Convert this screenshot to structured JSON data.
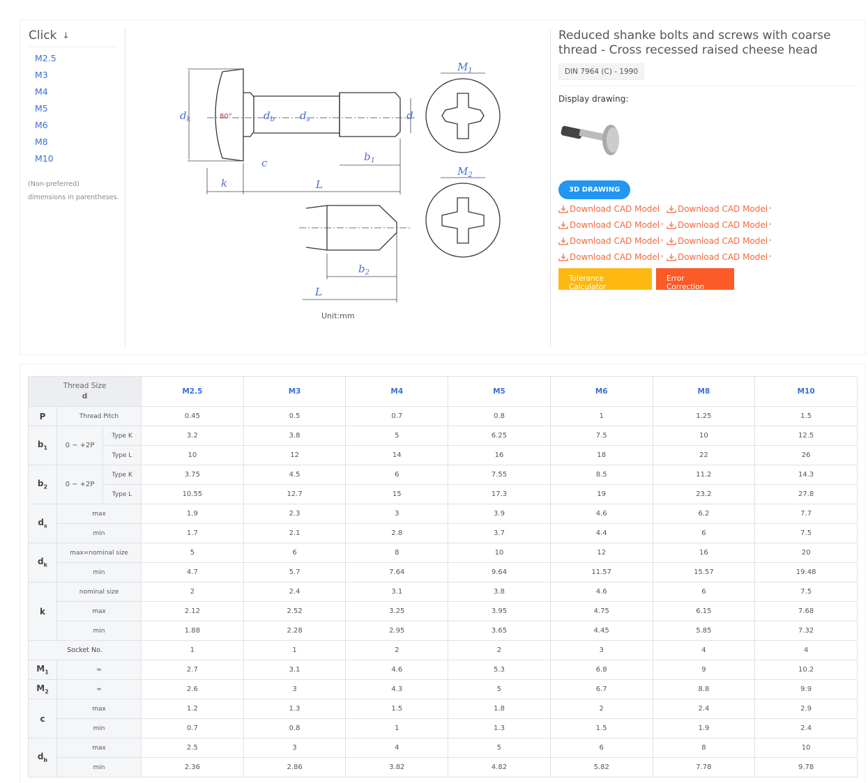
{
  "sidebar": {
    "title": "Click",
    "arrow": "↓",
    "sizes": [
      "M2.5",
      "M3",
      "M4",
      "M5",
      "M6",
      "M8",
      "M10"
    ],
    "note1": "(Non-preferred)",
    "note2": "dimensions in parentheses."
  },
  "drawing": {
    "dk": "d",
    "dk_sub": "k",
    "angle": "80°",
    "db": "d",
    "db_sub": "b",
    "ds": "d",
    "ds_sub": "s",
    "d": "d",
    "b1": "b",
    "b1_sub": "1",
    "c": "c",
    "k": "k",
    "L": "L",
    "M1": "M",
    "M1_sub": "1",
    "M2": "M",
    "M2_sub": "2",
    "b2": "b",
    "b2_sub": "2",
    "L2": "L",
    "unit": "Unit:mm"
  },
  "product": {
    "title": "Reduced shanke bolts and screws with coarse thread - Cross recessed raised cheese head",
    "standard": "DIN 7964 (C) - 1990",
    "display_label": "Display drawing:",
    "btn_3d": "3D DRAWING",
    "downloads": [
      "Download CAD Model",
      "Download CAD Model*",
      "Download CAD Model*",
      "Download CAD Model*",
      "Download CAD Model*",
      "Download CAD Model*",
      "Download CAD Model*",
      "Download CAD Model*"
    ],
    "tolerance": "Tolerance Calculator",
    "error": "Error Correction"
  },
  "table": {
    "corner1": "Thread Size",
    "corner2": "d",
    "sizes": [
      "M2.5",
      "M3",
      "M4",
      "M5",
      "M6",
      "M8",
      "M10"
    ],
    "groups": [
      {
        "sym": "P",
        "sub": "",
        "lines": [
          {
            "label": "Thread Pitch",
            "values": [
              "0.45",
              "0.5",
              "0.7",
              "0.8",
              "1",
              "1.25",
              "1.5"
            ]
          }
        ]
      },
      {
        "sym": "b",
        "sub": "1",
        "group": "0 ~ +2P",
        "lines": [
          {
            "label": "Type K",
            "values": [
              "3.2",
              "3.8",
              "5",
              "6.25",
              "7.5",
              "10",
              "12.5"
            ]
          },
          {
            "label": "Type L",
            "values": [
              "10",
              "12",
              "14",
              "16",
              "18",
              "22",
              "26"
            ]
          }
        ]
      },
      {
        "sym": "b",
        "sub": "2",
        "group": "0 ~ +2P",
        "lines": [
          {
            "label": "Type K",
            "values": [
              "3.75",
              "4.5",
              "6",
              "7.55",
              "8.5",
              "11.2",
              "14.3"
            ]
          },
          {
            "label": "Type L",
            "values": [
              "10.55",
              "12.7",
              "15",
              "17.3",
              "19",
              "23.2",
              "27.8"
            ]
          }
        ]
      },
      {
        "sym": "d",
        "sub": "s",
        "lines": [
          {
            "label": "max",
            "values": [
              "1.9",
              "2.3",
              "3",
              "3.9",
              "4.6",
              "6.2",
              "7.7"
            ]
          },
          {
            "label": "min",
            "values": [
              "1.7",
              "2.1",
              "2.8",
              "3.7",
              "4.4",
              "6",
              "7.5"
            ]
          }
        ]
      },
      {
        "sym": "d",
        "sub": "k",
        "lines": [
          {
            "label": "max=nominal size",
            "values": [
              "5",
              "6",
              "8",
              "10",
              "12",
              "16",
              "20"
            ]
          },
          {
            "label": "min",
            "values": [
              "4.7",
              "5.7",
              "7.64",
              "9.64",
              "11.57",
              "15.57",
              "19.48"
            ]
          }
        ]
      },
      {
        "sym": "k",
        "sub": "",
        "lines": [
          {
            "label": "nominal size",
            "values": [
              "2",
              "2.4",
              "3.1",
              "3.8",
              "4.6",
              "6",
              "7.5"
            ]
          },
          {
            "label": "max",
            "values": [
              "2.12",
              "2.52",
              "3.25",
              "3.95",
              "4.75",
              "6.15",
              "7.68"
            ]
          },
          {
            "label": "min",
            "values": [
              "1.88",
              "2.28",
              "2.95",
              "3.65",
              "4.45",
              "5.85",
              "7.32"
            ]
          }
        ]
      },
      {
        "full": "Socket No.",
        "lines": [
          {
            "values": [
              "1",
              "1",
              "2",
              "2",
              "3",
              "4",
              "4"
            ]
          }
        ]
      },
      {
        "sym": "M",
        "sub": "1",
        "lines": [
          {
            "label": "≈",
            "values": [
              "2.7",
              "3.1",
              "4.6",
              "5.3",
              "6.8",
              "9",
              "10.2"
            ]
          }
        ]
      },
      {
        "sym": "M",
        "sub": "2",
        "lines": [
          {
            "label": "≈",
            "values": [
              "2.6",
              "3",
              "4.3",
              "5",
              "6.7",
              "8.8",
              "9.9"
            ]
          }
        ]
      },
      {
        "sym": "c",
        "sub": "",
        "lines": [
          {
            "label": "max",
            "values": [
              "1.2",
              "1.3",
              "1.5",
              "1.8",
              "2",
              "2.4",
              "2.9"
            ]
          },
          {
            "label": "min",
            "values": [
              "0.7",
              "0.8",
              "1",
              "1.3",
              "1.5",
              "1.9",
              "2.4"
            ]
          }
        ]
      },
      {
        "sym": "d",
        "sub": "b",
        "lines": [
          {
            "label": "max",
            "values": [
              "2.5",
              "3",
              "4",
              "5",
              "6",
              "8",
              "10"
            ]
          },
          {
            "label": "min",
            "values": [
              "2.36",
              "2.86",
              "3.82",
              "4.82",
              "5.82",
              "7.78",
              "9.78"
            ]
          }
        ]
      }
    ]
  },
  "colors": {
    "link": "#3b6fd4",
    "accent_orange": "#f2683a",
    "blue_btn": "#2196f3",
    "yellow_btn": "#fdb812",
    "red_btn": "#fc5a26"
  }
}
